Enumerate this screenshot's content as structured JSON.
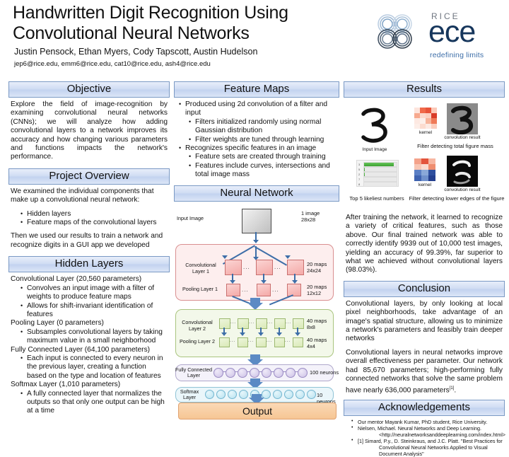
{
  "header": {
    "title": "Handwritten Digit Recognition Using Convolutional Neural Networks",
    "authors": "Justin Pensock, Ethan Myers, Cody Tapscott, Austin Hudelson",
    "emails": "jep6@rice.edu, emm6@rice.edu, cat10@rice.edu, ash4@rice.edu",
    "logo": {
      "org": "RICE",
      "dept": "ece",
      "tagline": "redefining limits"
    }
  },
  "objective": {
    "heading": "Objective",
    "body": "Explore the field of image-recognition by examining convolutional neural networks (CNNs); we will analyze how adding convolutional layers to a network improves its accuracy and how changing various parameters and functions impacts the network's performance."
  },
  "project_overview": {
    "heading": "Project Overview",
    "intro": "We examined the individual components that make up a convolutional neural network:",
    "bullets": [
      "Hidden layers",
      "Feature maps of the convolutional layers"
    ],
    "outro": "Then we used our results to train a network and recognize digits in a GUI app we developed"
  },
  "hidden_layers": {
    "heading": "Hidden Layers",
    "layers": [
      {
        "name": "Convolutional Layer (20,560 parameters)",
        "points": [
          "Convolves an input image with a filter of weights to produce feature maps",
          "Allows for shift-invariant identification of features"
        ]
      },
      {
        "name": "Pooling Layer (0 parameters)",
        "points": [
          "Subsamples convolutional layers by taking maximum value in a small neighborhood"
        ]
      },
      {
        "name": "Fully Connected Layer (64,100 parameters)",
        "points": [
          "Each input is connected to every neuron in the previous layer, creating a function based on the type and location of features"
        ]
      },
      {
        "name": "Softmax Layer (1,010 parameters)",
        "points": [
          "A fully connected layer that normalizes the outputs so that only one output can be high at a time"
        ]
      }
    ]
  },
  "feature_maps": {
    "heading": "Feature Maps",
    "bullets": [
      {
        "text": "Produced using 2d convolution of a filter and input",
        "sub": [
          "Filters initialized randomly using normal Gaussian distribution",
          "Filter weights are tuned through learning"
        ]
      },
      {
        "text": "Recognizes specific features in an image",
        "sub": [
          "Feature sets are created through training",
          "Features include curves, intersections and total image mass"
        ]
      }
    ]
  },
  "neural_network": {
    "heading": "Neural Network",
    "input_label": "Input Image",
    "input_size": "1 image\n28x28",
    "input_size_line1": "1 image",
    "input_size_line2": "28x28",
    "stages": [
      {
        "name": "Convolutional Layer 1",
        "maps": "20 maps",
        "dims": "24x24"
      },
      {
        "name": "Pooling  Layer 1",
        "maps": "20 maps",
        "dims": "12x12"
      },
      {
        "name": "Convolutional Layer 2",
        "maps": "40 maps",
        "dims": "8x8"
      },
      {
        "name": "Pooling  Layer 2",
        "maps": "40 maps",
        "dims": "4x4"
      },
      {
        "name": "Fully Connected Layer",
        "maps": "100 neurons",
        "dims": ""
      },
      {
        "name": "Softmax Layer",
        "maps": "10 neurons",
        "dims": ""
      }
    ],
    "conv1_label_l1": "Convolutional",
    "conv1_label_l2": "Layer 1",
    "pool1_label": "Pooling  Layer 1",
    "conv2_label_l1": "Convolutional",
    "conv2_label_l2": "Layer 2",
    "pool2_label": "Pooling  Layer 2",
    "fc_label_l1": "Fully Connected",
    "fc_label_l2": "Layer",
    "softmax_label_l1": "Softmax",
    "softmax_label_l2": "Layer",
    "fc_count": "100 neurons",
    "softmax_count": "10 neurons",
    "conv1_maps": "20 maps",
    "conv1_dims": "24x24",
    "pool1_maps": "20 maps",
    "pool1_dims": "12x12",
    "conv2_maps": "40 maps",
    "conv2_dims": "8x8",
    "pool2_maps": "40 maps",
    "pool2_dims": "4x4",
    "output_label": "Output",
    "ellipsis": "..."
  },
  "results": {
    "heading": "Results",
    "captions": {
      "input_image": "Input Image",
      "kernel": "kernel",
      "conv_result": "convolution result",
      "filter_top": "Filter detecting total figure mass",
      "filter_bottom": "Filter detecting lower edges of the figure",
      "top5": "Top 5 likeliest numbers"
    },
    "top5_rows": [
      {
        "label": "3",
        "value": 92
      },
      {
        "label": "5",
        "value": 3
      },
      {
        "label": "2",
        "value": 2
      },
      {
        "label": "7",
        "value": 1
      },
      {
        "label": "8",
        "value": 1
      }
    ],
    "body": "After training the network, it learned to recognize a variety of critical features, such as those above. Our final trained network was able to correctly identify 9939 out of 10,000 test images, yielding an accuracy of 99.39%, far superior to what we achieved without convolutional layers (98.03%)."
  },
  "conclusion": {
    "heading": "Conclusion",
    "p1": "Convolutional layers, by only looking at local pixel neighborhoods, take advantage of an image's spatial structure, allowing us to minimize a network's parameters and feasibly train deeper networks",
    "p2": "Convolutional layers in neural networks improve overall effectiveness per parameter. Our network had 85,670 parameters; high-performing fully connected networks that solve the same problem have nearly 636,000 parameters",
    "p2_sup": "[1]",
    "p2_end": "."
  },
  "acknowledgements": {
    "heading": "Acknowledgements",
    "items": [
      {
        "text": "Our mentor Mayank Kumar, PhD student, Rice University.",
        "indent": ""
      },
      {
        "text": "Nielsen, Michael. Neural Networks and Deep Learning.",
        "indent": "<http://neuralnetworksanddeeplearning.com/index.html>"
      },
      {
        "text": "[1] Simard, P.y., D. Steinkraus, and J.C. Platt. \"Best Practices for",
        "indent": "Convolutional Neural Networks Applied to Visual Document Analysis\""
      }
    ]
  },
  "colors": {
    "header_blue": "#c2d2ef",
    "header_border": "#7a99c4",
    "conv_red": "#f4a9a7",
    "conv_green": "#d9e9b6",
    "fc_purple": "#cdc2e6",
    "softmax_cyan": "#b7e2f0",
    "output_orange": "#f6c694",
    "arrow_blue": "#3d6ea8"
  }
}
